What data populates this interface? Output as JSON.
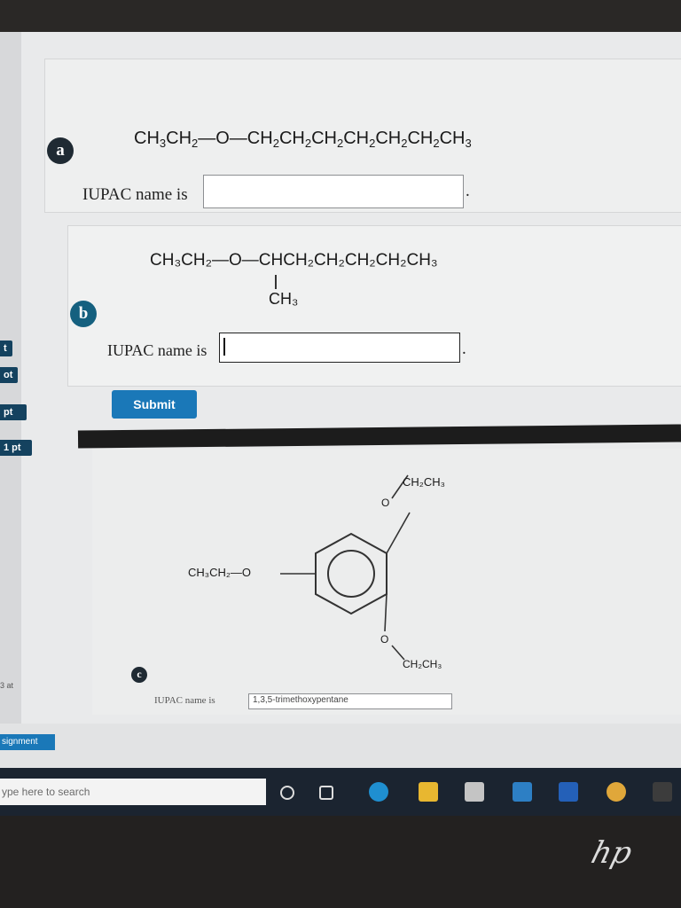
{
  "questions": {
    "a": {
      "badge": "a",
      "formula_parts": [
        "CH",
        "3",
        "CH",
        "2",
        "—O—CH",
        "2",
        "CH",
        "2",
        "CH",
        "2",
        "CH",
        "2",
        "CH",
        "2",
        "CH",
        "2",
        "CH",
        "3"
      ],
      "prompt": "IUPAC name is",
      "answer": "",
      "suffix": "."
    },
    "b": {
      "badge": "b",
      "formula_main": "CH₃CH₂—O—CHCH₂CH₂CH₂CH₂CH₃",
      "formula_branch": "CH₃",
      "prompt": "IUPAC name is",
      "answer": "",
      "suffix": "."
    },
    "c": {
      "badge": "c",
      "left_group": "CH₃CH₂—O",
      "top_group": "CH₂CH₃",
      "bottom_group": "CH₂CH₃",
      "top_o": "O",
      "bottom_o": "O",
      "prompt": "IUPAC name is",
      "answer": "1,3,5-trimethoxypentane"
    }
  },
  "submit_label": "Submit",
  "side_tabs": [
    "t",
    "ot",
    "pt",
    "1 pt"
  ],
  "side_text": "3 at",
  "assignment_label": "signment",
  "taskbar": {
    "search_placeholder": "ype here to search"
  },
  "brand": "hp"
}
